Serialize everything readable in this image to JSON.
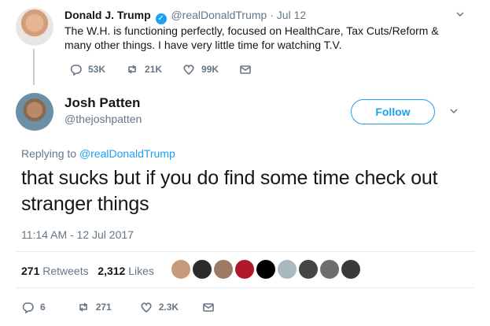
{
  "parent_tweet": {
    "name": "Donald J. Trump",
    "handle": "@realDonaldTrump",
    "separator": "·",
    "date": "Jul 12",
    "text": "The W.H. is functioning perfectly, focused on HealthCare, Tax Cuts/Reform & many other things. I have very little time for watching T.V.",
    "actions": {
      "replies": "53K",
      "retweets": "21K",
      "likes": "99K"
    }
  },
  "main_tweet": {
    "name": "Josh Patten",
    "handle": "@thejoshpatten",
    "follow_label": "Follow",
    "replying_prefix": "Replying to",
    "replying_to": "@realDonaldTrump",
    "text": "that sucks but if you do find some time check out stranger things",
    "timestamp": "11:14 AM - 12 Jul 2017",
    "retweet_count": "271",
    "retweet_label": "Retweets",
    "like_count": "2,312",
    "like_label": "Likes",
    "actions": {
      "replies": "6",
      "retweets": "271",
      "likes": "2.3K"
    }
  },
  "likers": [
    "#c89a7a",
    "#2b2b2b",
    "#9c7b66",
    "#b0182a",
    "#000000",
    "#aab8c2",
    "#444444",
    "#6e6e6e",
    "#3a3a3a"
  ],
  "colors": {
    "accent": "#1da1f2",
    "muted": "#657786",
    "text": "#14171a"
  }
}
